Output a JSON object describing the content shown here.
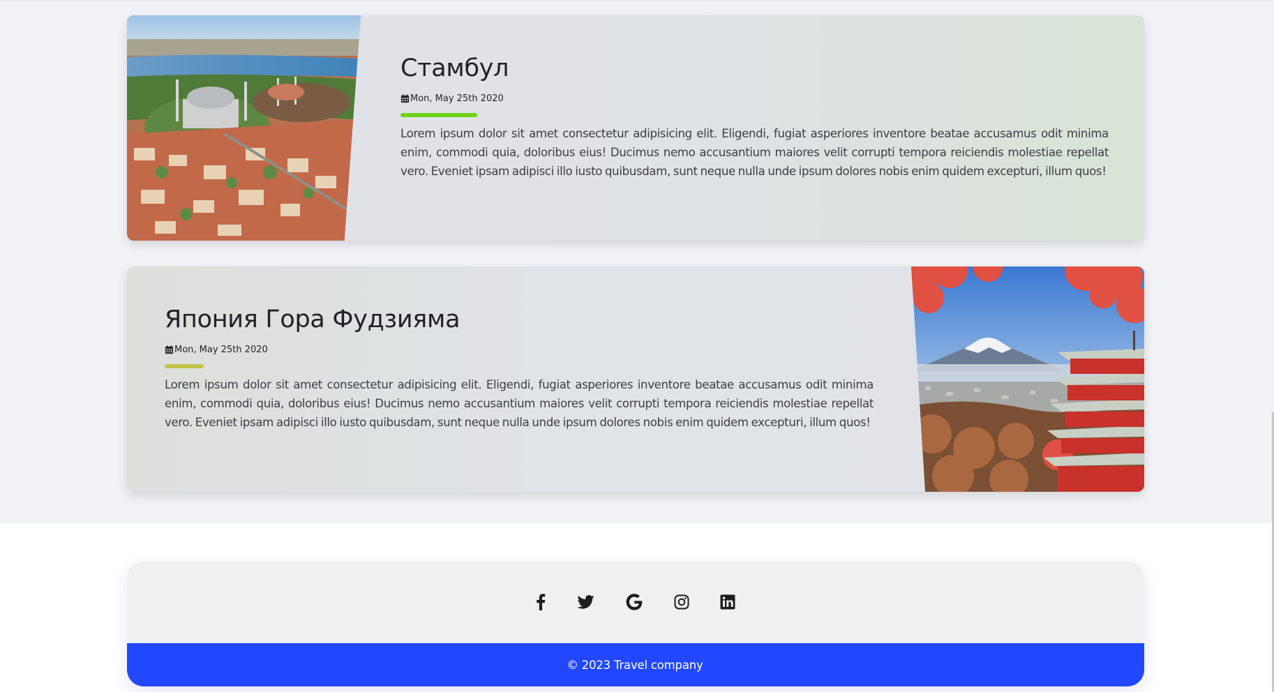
{
  "posts": [
    {
      "title": "Стамбул",
      "date": "Mon, May 25th 2020",
      "text": "Lorem ipsum dolor sit amet consectetur adipisicing elit. Eligendi, fugiat asperiores inventore beatae accusamus odit minima enim, commodi quia, doloribus eius! Ducimus nemo accusantium maiores velit corrupti tempora reiciendis molestiae repellat vero. Eveniet ipsam adipisci illo iusto quibusdam, sunt neque nulla unde ipsum dolores nobis enim quidem excepturi, illum quos!",
      "accent_color": "#6fd219"
    },
    {
      "title": "Япония Гора Фудзияма",
      "date": "Mon, May 25th 2020",
      "text": "Lorem ipsum dolor sit amet consectetur adipisicing elit. Eligendi, fugiat asperiores inventore beatae accusamus odit minima enim, commodi quia, doloribus eius! Ducimus nemo accusantium maiores velit corrupti tempora reiciendis molestiae repellat vero. Eveniet ipsam adipisci illo iusto quibusdam, sunt neque nulla unde ipsum dolores nobis enim quidem excepturi, illum quos!",
      "accent_color": "#c2c44a"
    }
  ],
  "footer": {
    "social_icons": [
      "facebook-icon",
      "twitter-icon",
      "google-icon",
      "instagram-icon",
      "linkedin-icon"
    ],
    "copyright": "© 2023 Travel company",
    "bar_color": "#2147ff"
  }
}
